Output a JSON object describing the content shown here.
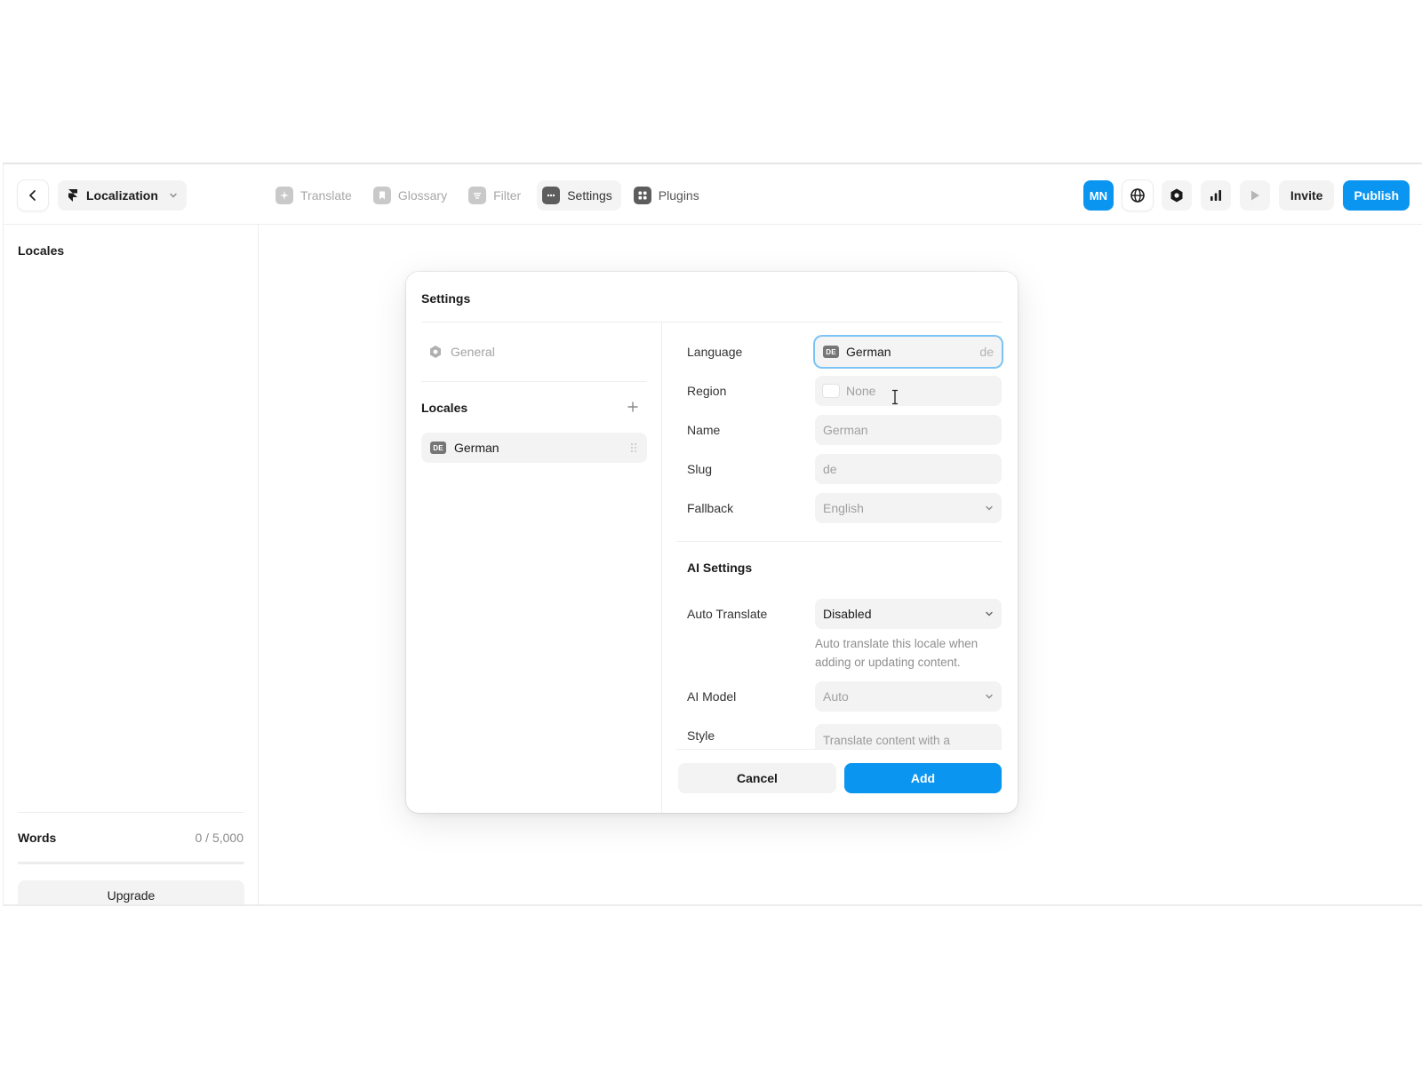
{
  "colors": {
    "accent": "#0a95f0",
    "focus_ring": "#7cc4f5",
    "field_bg": "#f3f3f3"
  },
  "header": {
    "project_name": "Localization",
    "tabs": [
      {
        "label": "Translate",
        "icon": "sparkle-icon",
        "state": "disabled"
      },
      {
        "label": "Glossary",
        "icon": "bookmark-icon",
        "state": "disabled"
      },
      {
        "label": "Filter",
        "icon": "filter-icon",
        "state": "disabled"
      },
      {
        "label": "Settings",
        "icon": "more-dots-icon",
        "state": "active"
      },
      {
        "label": "Plugins",
        "icon": "plugins-grid-icon",
        "state": "normal"
      }
    ],
    "avatar_initials": "MN",
    "invite_label": "Invite",
    "publish_label": "Publish"
  },
  "sidebar": {
    "title": "Locales",
    "words_label": "Words",
    "words_count": "0 / 5,000",
    "words_used_fraction": 0,
    "upgrade_label": "Upgrade"
  },
  "modal": {
    "title": "Settings",
    "general_label": "General",
    "locales_title": "Locales",
    "locales": [
      {
        "badge": "DE",
        "name": "German"
      }
    ],
    "form": {
      "language": {
        "label": "Language",
        "badge": "DE",
        "value": "German",
        "code": "de"
      },
      "region": {
        "label": "Region",
        "value": "None"
      },
      "name": {
        "label": "Name",
        "placeholder": "German"
      },
      "slug": {
        "label": "Slug",
        "placeholder": "de"
      },
      "fallback": {
        "label": "Fallback",
        "value": "English"
      }
    },
    "ai": {
      "title": "AI Settings",
      "auto_translate": {
        "label": "Auto Translate",
        "value": "Disabled",
        "hint": "Auto translate this locale when adding or updating content."
      },
      "model": {
        "label": "AI Model",
        "value": "Auto"
      },
      "style": {
        "label": "Style",
        "placeholder": "Translate content with a cheerful tone, intended for an"
      }
    },
    "cancel_label": "Cancel",
    "add_label": "Add"
  }
}
